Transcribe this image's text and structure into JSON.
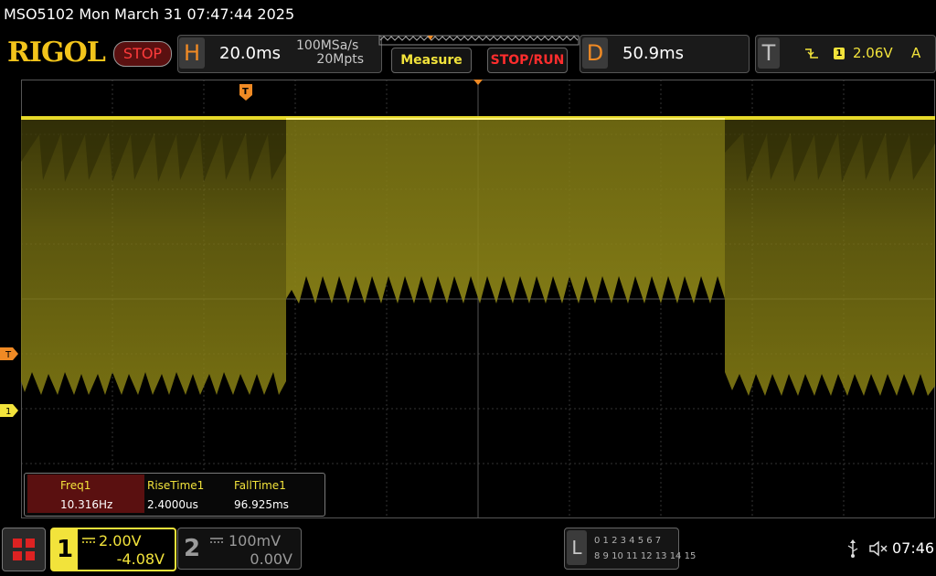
{
  "title_bar": {
    "text": "MSO5102  Mon March 31 07:47:44 2025"
  },
  "header": {
    "logo": "RIGOL",
    "run_state": "STOP",
    "horizontal": {
      "letter": "H",
      "timebase": "20.0ms",
      "sample_rate": "100MSa/s",
      "memory_depth": "20Mpts"
    },
    "measure_label": "Measure",
    "stoprun_label": "STOP/RUN",
    "delay": {
      "letter": "D",
      "value": "50.9ms"
    },
    "trigger": {
      "letter": "T",
      "source": "1",
      "level": "2.06V",
      "mode": "A"
    }
  },
  "side_markers": {
    "trigger_level": "T",
    "ch1_ground": "1",
    "trigger_position": "T"
  },
  "measurements": [
    {
      "label": "Freq1",
      "value": "10.316Hz"
    },
    {
      "label": "RiseTime1",
      "value": "2.4000us"
    },
    {
      "label": "FallTime1",
      "value": "96.925ms"
    }
  ],
  "channels": [
    {
      "num": "1",
      "scale": "2.00V",
      "offset": "-4.08V",
      "color": "#f2e33b",
      "active": true
    },
    {
      "num": "2",
      "scale": "100mV",
      "offset": "0.00V",
      "color": "#9a9a9a",
      "active": false
    }
  ],
  "logic_analyzer": {
    "letter": "L",
    "row1": "0 1 2 3   4 5 6 7",
    "row2": "8 9 10 11  12 13 14 15"
  },
  "status": {
    "clock": "07:46"
  },
  "colors": {
    "accent_yellow": "#f2e33b",
    "orange": "#f08a24",
    "stop_red": "#ff2d2d",
    "grid": "#3a3a3a"
  }
}
